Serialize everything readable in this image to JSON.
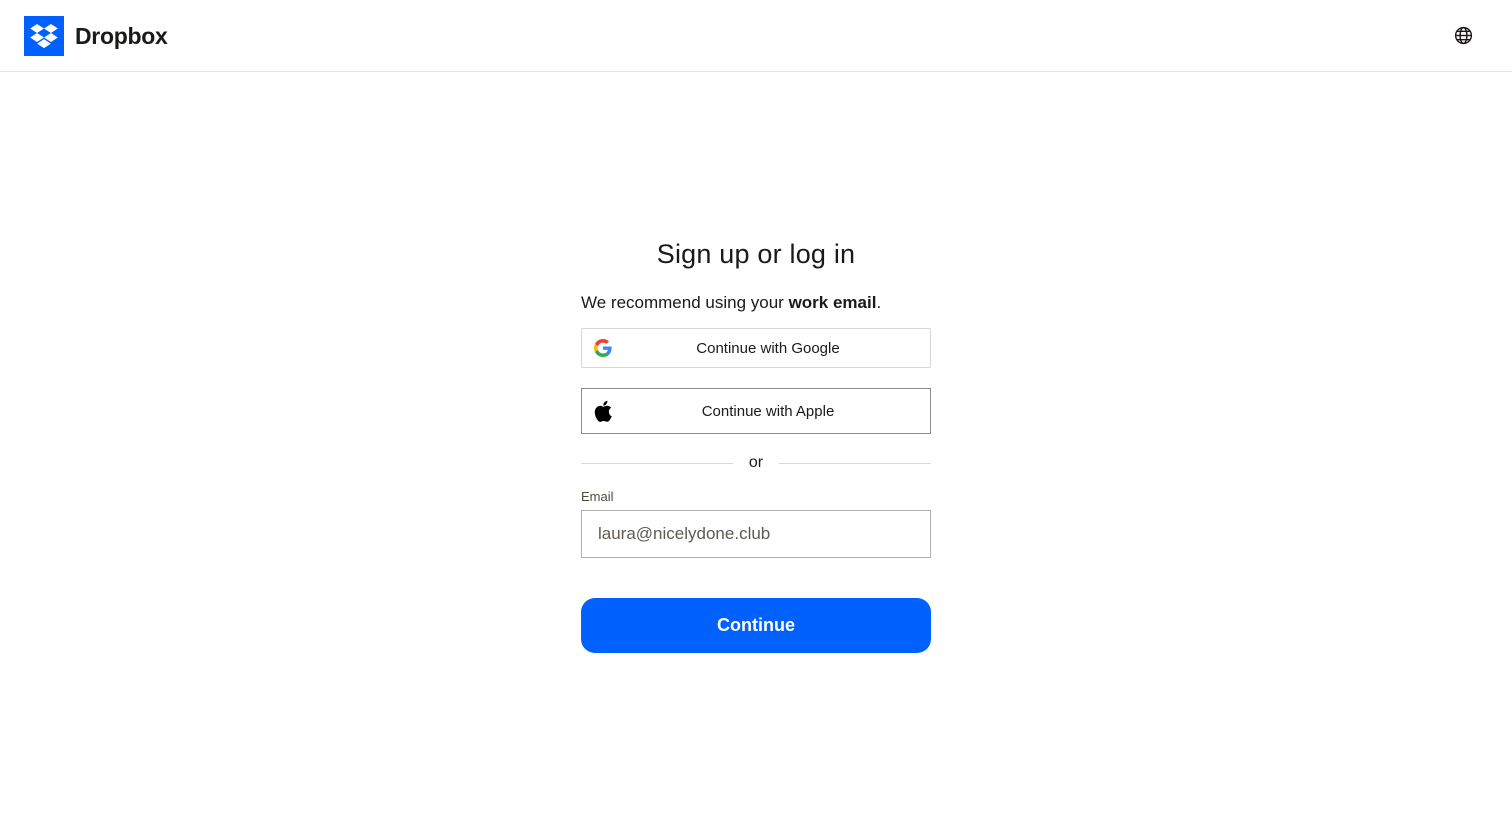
{
  "header": {
    "brand_name": "Dropbox",
    "logo_icon": "dropbox-logo-icon",
    "language_icon": "globe-icon"
  },
  "form": {
    "title": "Sign up or log in",
    "recommend_prefix": "We recommend using your ",
    "recommend_bold": "work email",
    "recommend_suffix": ".",
    "google_label": "Continue with Google",
    "apple_label": "Continue with Apple",
    "divider_text": "or",
    "email_label": "Email",
    "email_value": "laura@nicelydone.club",
    "continue_label": "Continue"
  },
  "colors": {
    "accent": "#0061fe",
    "text": "#1e1919",
    "border": "#d9d6d2"
  }
}
